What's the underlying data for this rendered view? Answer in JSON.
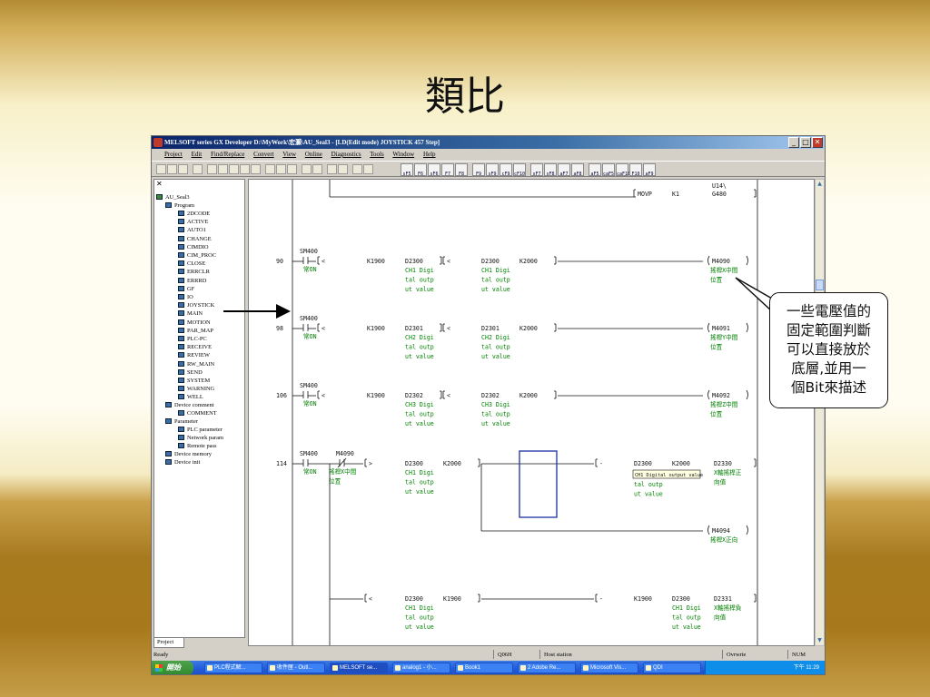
{
  "slide": {
    "title": "類比",
    "callout_lines": [
      "一些電壓值的",
      "固定範圍判斷",
      "可以直接放於",
      "底層,並用一",
      "個Bit來描述"
    ]
  },
  "window": {
    "title": "MELSOFT series GX Developer D:\\MyWork\\宏灝\\AU_Seal3 - [LD(Edit mode)    JOYSTICK    457 Step]",
    "menu": [
      "Project",
      "Edit",
      "Find/Replace",
      "Convert",
      "View",
      "Online",
      "Diagnostics",
      "Tools",
      "Window",
      "Help"
    ],
    "fkeys": [
      "sF5",
      "F6",
      "sF6",
      "F7",
      "F8",
      "F9",
      "sF9",
      "cF9",
      "cF10",
      "sF7",
      "sF8",
      "aF7",
      "aF8",
      "aF5",
      "caF5",
      "caF10",
      "F10",
      "aF9"
    ]
  },
  "tree": {
    "root": "AU_Seal3",
    "program": "Program",
    "programs": [
      "2DCODE",
      "ACTIVE",
      "AUTO1",
      "CHANGE",
      "CIMDIO",
      "CIM_PROC",
      "CLOSE",
      "ERRCLR",
      "ERRRD",
      "GF",
      "IO",
      "JOYSTICK",
      "MAIN",
      "MOTION",
      "PAR_MAP",
      "PLC-PC",
      "RECEIVE",
      "REVIEW",
      "RW_MAIN",
      "SEND",
      "SYSTEM",
      "WARNING",
      "WELL"
    ],
    "device_comment": "Device comment",
    "comment": "COMMENT",
    "parameter": "Parameter",
    "parameters": [
      "PLC parameter",
      "Network param",
      "Remote pass"
    ],
    "device_memory": "Device memory",
    "device_init": "Device init",
    "tab": "Project"
  },
  "ladder": {
    "top": {
      "instr": "MOVP",
      "src": "K1",
      "dst_top": "U14\\",
      "dst": "G480"
    },
    "rungs": [
      {
        "step": "90",
        "contact": "SM400",
        "contact_cmt": "常ON",
        "op": "<",
        "k": "K1900",
        "d": "D2300",
        "cmt": [
          "CH1 Digi",
          "tal outp",
          "ut value"
        ],
        "op2": "<",
        "d2": "D2300",
        "k2": "K2000",
        "cmt2": [
          "CH1 Digi",
          "tal outp",
          "ut value"
        ],
        "coil": "M4090",
        "coil_cmt": [
          "搖桿X中間",
          "位置"
        ]
      },
      {
        "step": "98",
        "contact": "SM400",
        "contact_cmt": "常ON",
        "op": "<",
        "k": "K1900",
        "d": "D2301",
        "cmt": [
          "CH2 Digi",
          "tal outp",
          "ut value"
        ],
        "op2": "<",
        "d2": "D2301",
        "k2": "K2000",
        "cmt2": [
          "CH2 Digi",
          "tal outp",
          "ut value"
        ],
        "coil": "M4091",
        "coil_cmt": [
          "搖桿Y中間",
          "位置"
        ]
      },
      {
        "step": "106",
        "contact": "SM400",
        "contact_cmt": "常ON",
        "op": "<",
        "k": "K1900",
        "d": "D2302",
        "cmt": [
          "CH3 Digi",
          "tal outp",
          "ut value"
        ],
        "op2": "<",
        "d2": "D2302",
        "k2": "K2000",
        "cmt2": [
          "CH3 Digi",
          "tal outp",
          "ut value"
        ],
        "coil": "M4092",
        "coil_cmt": [
          "搖桿Z中間",
          "位置"
        ]
      }
    ],
    "rung114": {
      "step": "114",
      "c1": "SM400",
      "c1_cmt": "常ON",
      "c2": "M4090",
      "c2_cmt": [
        "搖桿X中間",
        "位置"
      ],
      "op": ">",
      "d": "D2300",
      "k": "K2000",
      "cmt": [
        "CH1 Digi",
        "tal outp",
        "ut value"
      ],
      "r_op": "-",
      "r_d": "D2300",
      "r_k": "K2000",
      "r_dst": "D2330",
      "r_dst_cmt": [
        "X軸搖桿正",
        "向值"
      ],
      "tooltip": "CH1 Digital output value",
      "r_cmt": [
        "tal outp",
        "ut value"
      ],
      "coil": "M4094",
      "coil_cmt": "搖桿X正向"
    },
    "rung_b": {
      "op": "<",
      "d": "D2300",
      "k": "K1900",
      "cmt": [
        "CH1 Digi",
        "tal outp",
        "ut value"
      ],
      "r_op": "-",
      "r_k": "K1900",
      "r_d": "D2300",
      "r_dst": "D2331",
      "r_cmt": [
        "CH1 Digi",
        "tal outp",
        "ut value"
      ],
      "r_dst_cmt": [
        "X軸搖桿負",
        "向值"
      ]
    }
  },
  "status": {
    "ready": "Ready",
    "cpu": "Q06H",
    "station": "Host station",
    "mode": "Ovrwrte",
    "num": "NUM"
  },
  "taskbar": {
    "start": "開始",
    "tasks": [
      "PLC程式解...",
      "收件匣 - Outl...",
      "MELSOFT se...",
      "analog1 - 小...",
      "Book1",
      "2 Adobe Re...",
      "Microsoft Vis...",
      "QDI"
    ],
    "clock": "下午 11:29"
  },
  "colors": {
    "comment": "#008000",
    "accent_box": "#2a3fa8",
    "titlebar": "#0a246a"
  }
}
